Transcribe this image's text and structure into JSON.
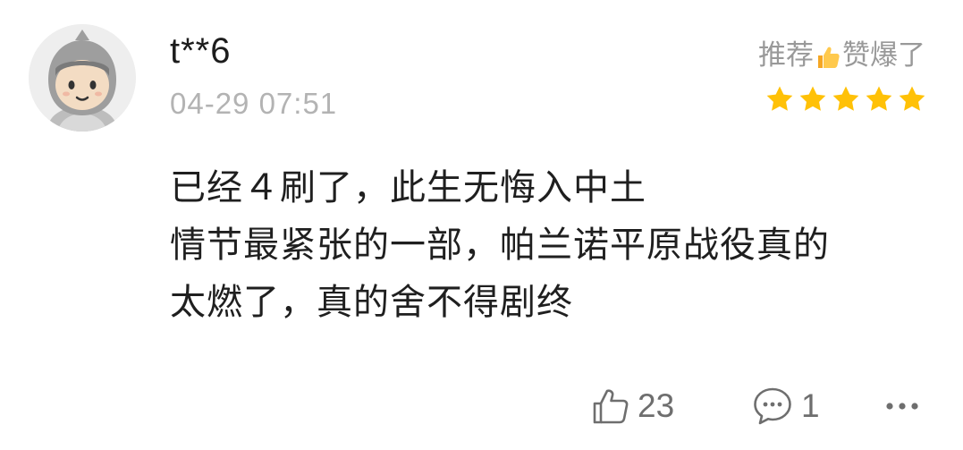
{
  "review": {
    "username": "t**6",
    "timestamp": "04-29 07:51",
    "rating_prefix": "推荐",
    "rating_suffix": "赞爆了",
    "stars": 5,
    "content_lines": [
      "已经４刷了，此生无悔入中土",
      "情节最紧张的一部，帕兰诺平原战役真的",
      "太燃了，真的舍不得剧终"
    ]
  },
  "actions": {
    "like_count": "23",
    "comment_count": "1"
  },
  "colors": {
    "star": "#ffc107",
    "muted_text": "#b3b3b3",
    "body_text": "#1f1f1f"
  },
  "icons": {
    "like": "thumbs-up-icon",
    "comment": "comment-bubble-icon",
    "more": "more-dots-icon"
  }
}
